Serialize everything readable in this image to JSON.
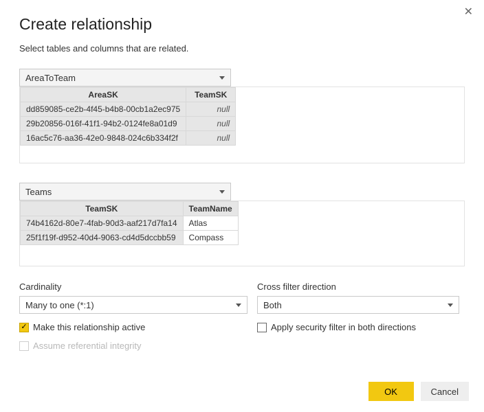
{
  "dialog": {
    "title": "Create relationship",
    "subtitle": "Select tables and columns that are related.",
    "close_glyph": "✕"
  },
  "table1": {
    "selected": "AreaToTeam",
    "columns": [
      "AreaSK",
      "TeamSK"
    ],
    "rows": [
      {
        "AreaSK": "dd859085-ce2b-4f45-b4b8-00cb1a2ec975",
        "TeamSK": "null"
      },
      {
        "AreaSK": "29b20856-016f-41f1-94b2-0124fe8a01d9",
        "TeamSK": "null"
      },
      {
        "AreaSK": "16ac5c76-aa36-42e0-9848-024c6b334f2f",
        "TeamSK": "null"
      }
    ]
  },
  "table2": {
    "selected": "Teams",
    "columns": [
      "TeamSK",
      "TeamName"
    ],
    "rows": [
      {
        "TeamSK": "74b4162d-80e7-4fab-90d3-aaf217d7fa14",
        "TeamName": "Atlas"
      },
      {
        "TeamSK": "25f1f19f-d952-40d4-9063-cd4d5dccbb59",
        "TeamName": "Compass"
      }
    ]
  },
  "options": {
    "cardinality_label": "Cardinality",
    "cardinality_value": "Many to one (*:1)",
    "crossfilter_label": "Cross filter direction",
    "crossfilter_value": "Both",
    "make_active_label": "Make this relationship active",
    "make_active_checked": true,
    "apply_security_label": "Apply security filter in both directions",
    "apply_security_checked": false,
    "assume_ref_label": "Assume referential integrity",
    "assume_ref_enabled": false
  },
  "buttons": {
    "ok": "OK",
    "cancel": "Cancel"
  },
  "glyphs": {
    "check": "✓"
  }
}
